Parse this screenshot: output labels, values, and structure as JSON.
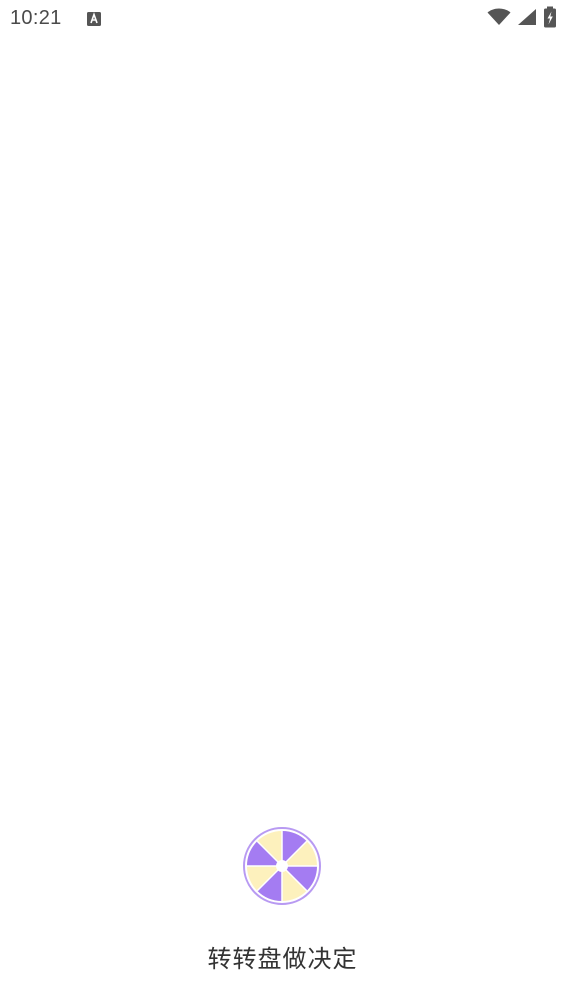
{
  "status_bar": {
    "time": "10:21",
    "notification_icon": "font-download-icon",
    "wifi_icon": "wifi-icon",
    "signal_icon": "cellular-signal-icon",
    "battery_icon": "battery-charging-icon"
  },
  "splash": {
    "logo_icon": "spin-wheel-icon",
    "title": "转转盘做决定"
  },
  "colors": {
    "wheel_purple": "#a47cf2",
    "wheel_yellow": "#fdf1bd",
    "status_icon": "#555555",
    "title_text": "#333333"
  }
}
